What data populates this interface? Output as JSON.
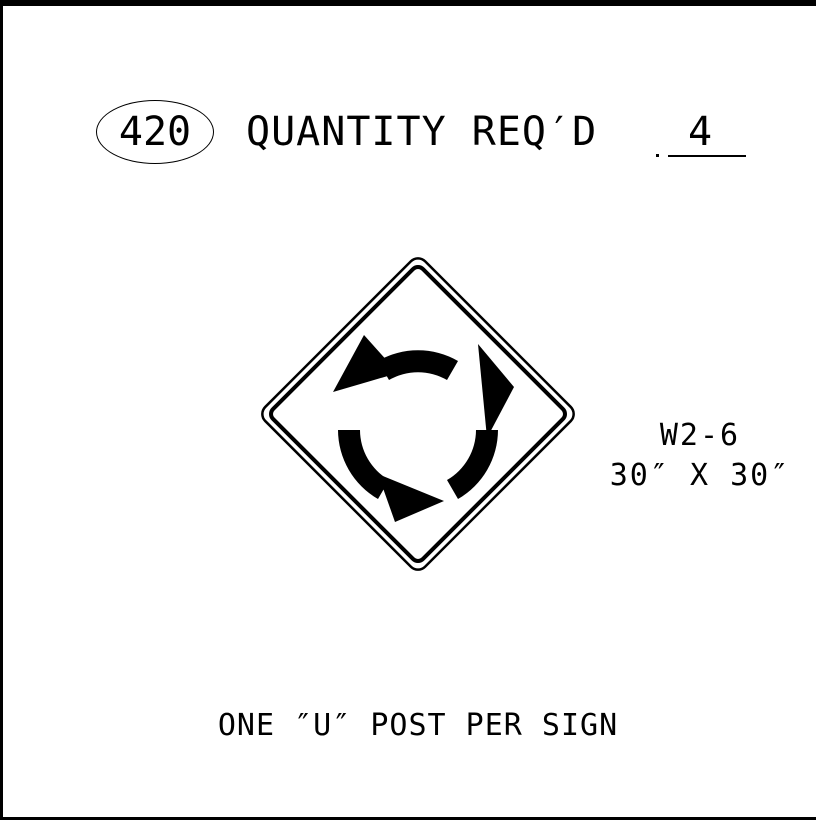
{
  "header": {
    "sheet_number": "420",
    "quantity_label": "QUANTITY REQ′D",
    "quantity_value": "4"
  },
  "sign": {
    "icon": "roundabout-circulation-icon",
    "code": "W2-6",
    "size": "30″ X 30″"
  },
  "notes": {
    "post": "ONE ″U″ POST PER SIGN"
  },
  "colors": {
    "ink": "#000000",
    "background": "#ffffff"
  }
}
